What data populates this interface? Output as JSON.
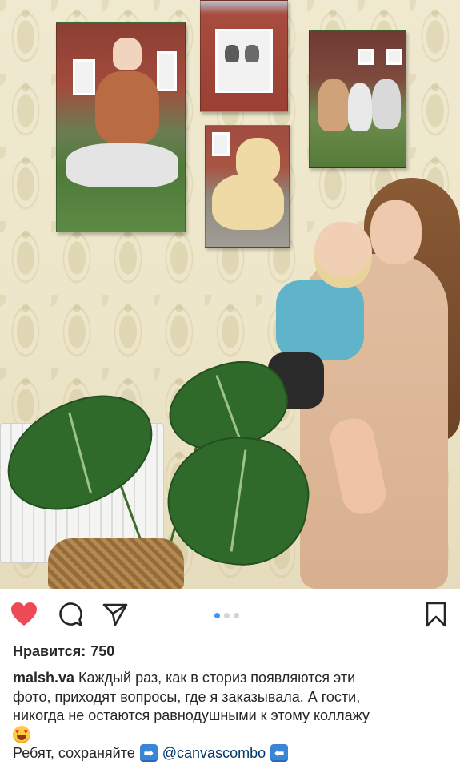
{
  "post": {
    "likes_label": "Нравится:",
    "likes_count": "750",
    "username": "malsh.va",
    "caption_line1": "Каждый раз, как в сториз появляются эти",
    "caption_line2": "фото, приходят вопросы, где я заказывала.  А гости,",
    "caption_line3": "никогда не остаются равнодушными к этому коллажу",
    "cta_text": "Ребят, сохраняйте",
    "mention": "@canvascombo",
    "arrow_right": "➡",
    "arrow_left": "⬅"
  },
  "actions": {
    "like_icon": "heart-filled-icon",
    "comment_icon": "comment-bubble-icon",
    "share_icon": "paper-plane-icon",
    "save_icon": "bookmark-icon",
    "like_color": "#ed4956"
  },
  "carousel": {
    "total": 3,
    "active_index": 0,
    "active_color": "#3897f0"
  }
}
